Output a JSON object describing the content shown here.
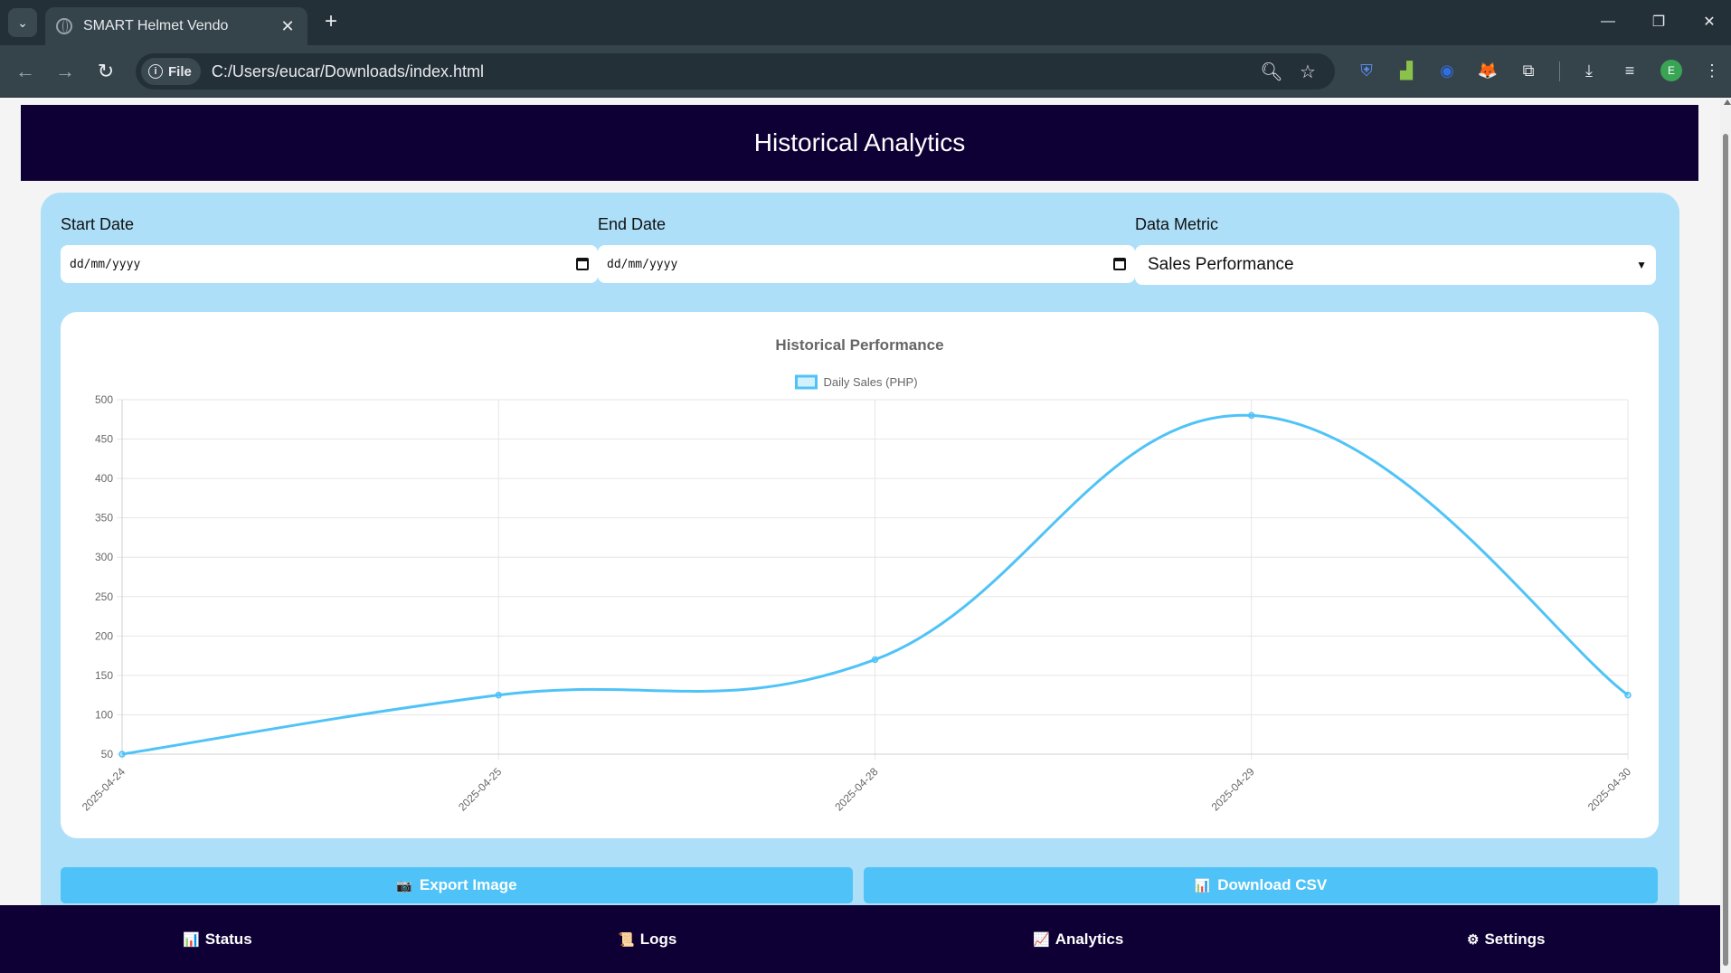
{
  "browser": {
    "tab_title": "SMART Helmet Vendo",
    "site_chip": "File",
    "url": "C:/Users/eucar/Downloads/index.html",
    "profile_initial": "E"
  },
  "page": {
    "header_title": "Historical Analytics",
    "filters": {
      "start_label": "Start Date",
      "start_placeholder": "dd/mm/yyyy",
      "end_label": "End Date",
      "end_placeholder": "dd/mm/yyyy",
      "metric_label": "Data Metric",
      "metric_value": "Sales Performance"
    },
    "buttons": {
      "export_icon": "📷",
      "export_label": "Export Image",
      "csv_icon": "📊",
      "csv_label": "Download CSV"
    },
    "bottom_nav": [
      {
        "icon": "📊",
        "label": "Status"
      },
      {
        "icon": "📜",
        "label": "Logs"
      },
      {
        "icon": "📈",
        "label": "Analytics"
      },
      {
        "icon": "⚙",
        "label": "Settings"
      }
    ]
  },
  "colors": {
    "header_bg": "#0e0035",
    "panel_bg": "#aedff8",
    "accent": "#4fc3f7",
    "line": "#4fc3f7"
  },
  "chart_data": {
    "type": "line",
    "title": "Historical Performance",
    "categories": [
      "2025-04-24",
      "2025-04-25",
      "2025-04-28",
      "2025-04-29",
      "2025-04-30"
    ],
    "series": [
      {
        "name": "Daily Sales (PHP)",
        "values": [
          50,
          125,
          170,
          480,
          125
        ]
      }
    ],
    "ylim": [
      50,
      500
    ],
    "yticks": [
      50,
      100,
      150,
      200,
      250,
      300,
      350,
      400,
      450,
      500
    ],
    "grid": true,
    "legend": "top-center",
    "line_color": "#4fc3f7"
  }
}
